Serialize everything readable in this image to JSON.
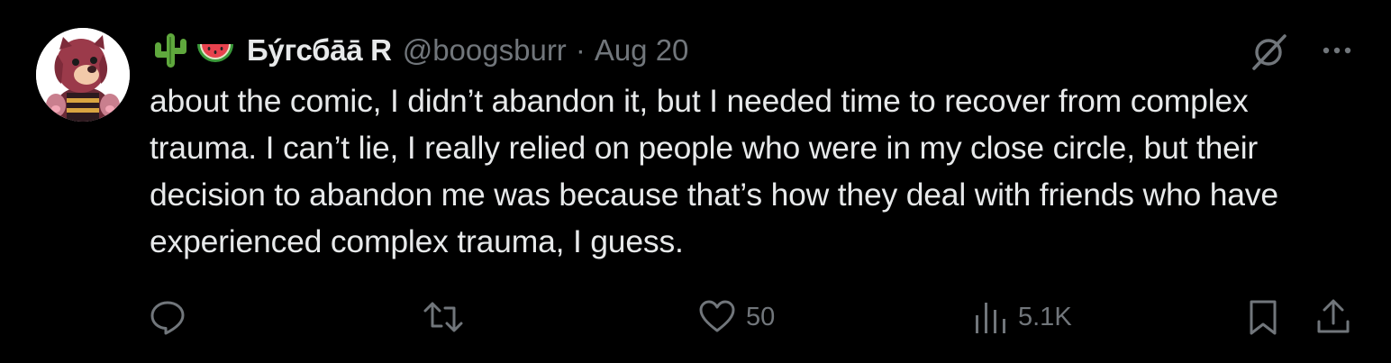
{
  "tweet": {
    "display_name": "Бýгсбāā R",
    "handle": "@boogsburr",
    "separator": "·",
    "date": "Aug 20",
    "name_emojis": [
      "cactus-emoji",
      "watermelon-emoji"
    ],
    "text": "about the comic, I didn’t abandon it, but I needed time to recover from complex trauma. I can’t lie, I really relied on people who were in my close circle, but their decision to abandon me was because that’s how they deal with friends who have experienced complex trauma, I guess."
  },
  "actions": {
    "reply_count": "",
    "retweet_count": "",
    "like_count": "50",
    "view_count": "5.1K"
  },
  "icons": [
    "grok-icon",
    "more-icon",
    "reply-icon",
    "retweet-icon",
    "heart-icon",
    "views-icon",
    "bookmark-icon",
    "share-icon"
  ],
  "colors": {
    "background": "#000000",
    "text": "#e7e9ea",
    "secondary": "#71767b"
  }
}
